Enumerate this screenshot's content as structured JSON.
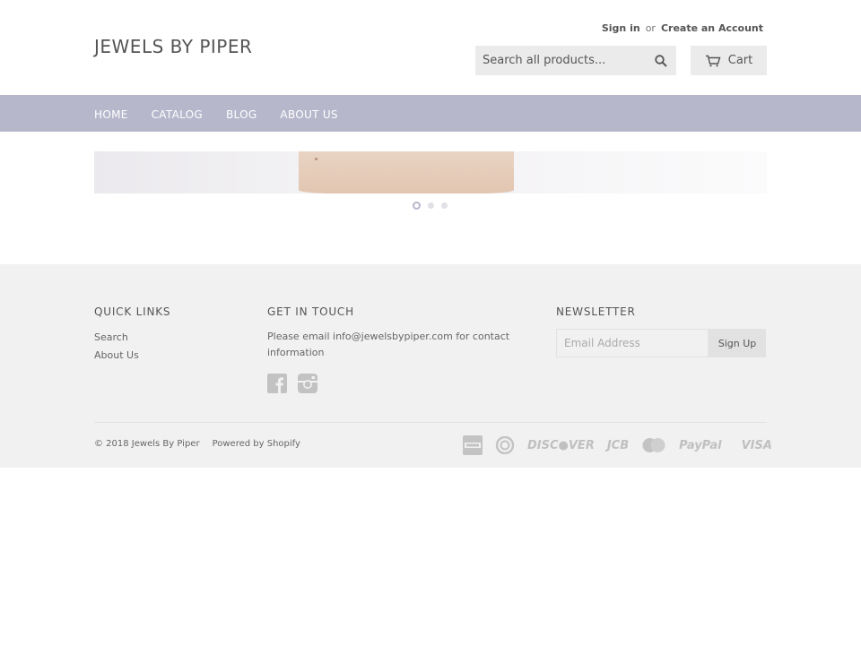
{
  "header": {
    "logo": "JEWELS BY PIPER",
    "sign_in": "Sign in",
    "or": "or",
    "create_account": "Create an Account",
    "search_placeholder": "Search all products...",
    "cart_label": "Cart"
  },
  "nav": {
    "items": [
      "HOME",
      "CATALOG",
      "BLOG",
      "ABOUT US"
    ]
  },
  "slider": {
    "slide_count": 3,
    "active_index": 0
  },
  "footer": {
    "quick_links": {
      "heading": "QUICK LINKS",
      "links": [
        "Search",
        "About Us"
      ]
    },
    "contact": {
      "heading": "GET IN TOUCH",
      "text": "Please email info@jewelsbypiper.com for contact information"
    },
    "newsletter": {
      "heading": "NEWSLETTER",
      "placeholder": "Email Address",
      "button": "Sign Up"
    },
    "copyright": "© 2018 Jewels By Piper",
    "powered_by": "Powered by Shopify",
    "payments": [
      "american-express-icon",
      "diners-club-icon",
      "DISC●VER",
      "JCB",
      "mastercard-icon",
      "PayPal",
      "VISA"
    ]
  },
  "colors": {
    "nav_bg": "#b7b7cc",
    "footer_bg": "#f1f1f1",
    "button_bg": "#ebebeb"
  }
}
